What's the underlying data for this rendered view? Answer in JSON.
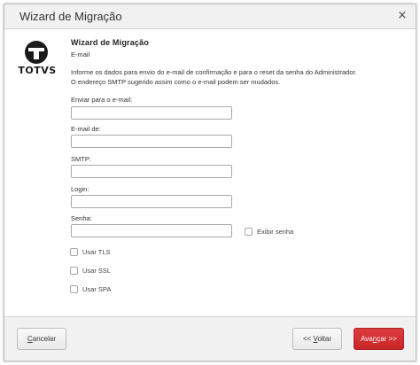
{
  "window": {
    "title": "Wizard de Migração",
    "close_glyph": "×"
  },
  "logo": {
    "text": "TOTVS",
    "icon": "totvs-logo-icon"
  },
  "page": {
    "heading": "Wizard de Migração",
    "subheading": "E-mail",
    "info_line1": "Informe os dados para envio do e-mail de confirmação e para o reset da senha do Administrador.",
    "info_line2": "O endereço SMTP sugerido assim como o e-mail podem ser mudados."
  },
  "form": {
    "send_to_label": "Enviar para o e-mail:",
    "send_to_value": "",
    "email_from_label": "E-mail de:",
    "email_from_value": "",
    "smtp_label": "SMTP:",
    "smtp_value": "",
    "login_label": "Login:",
    "login_value": "",
    "password_label": "Senha:",
    "password_value": "",
    "show_password_label": "Exibir senha",
    "use_tls_label": "Usar TLS",
    "use_ssl_label": "Usar SSL",
    "use_spa_label": "Usar SPA"
  },
  "footer": {
    "cancel_first": "C",
    "cancel_rest": "ancelar",
    "back_prefix": "<< ",
    "back_underlined": "V",
    "back_rest": "oltar",
    "next_prefix": "Ava",
    "next_underlined": "n",
    "next_rest": "çar >>"
  },
  "colors": {
    "primary": "#cf2a2d",
    "titlebar": "#f1f1f1"
  }
}
